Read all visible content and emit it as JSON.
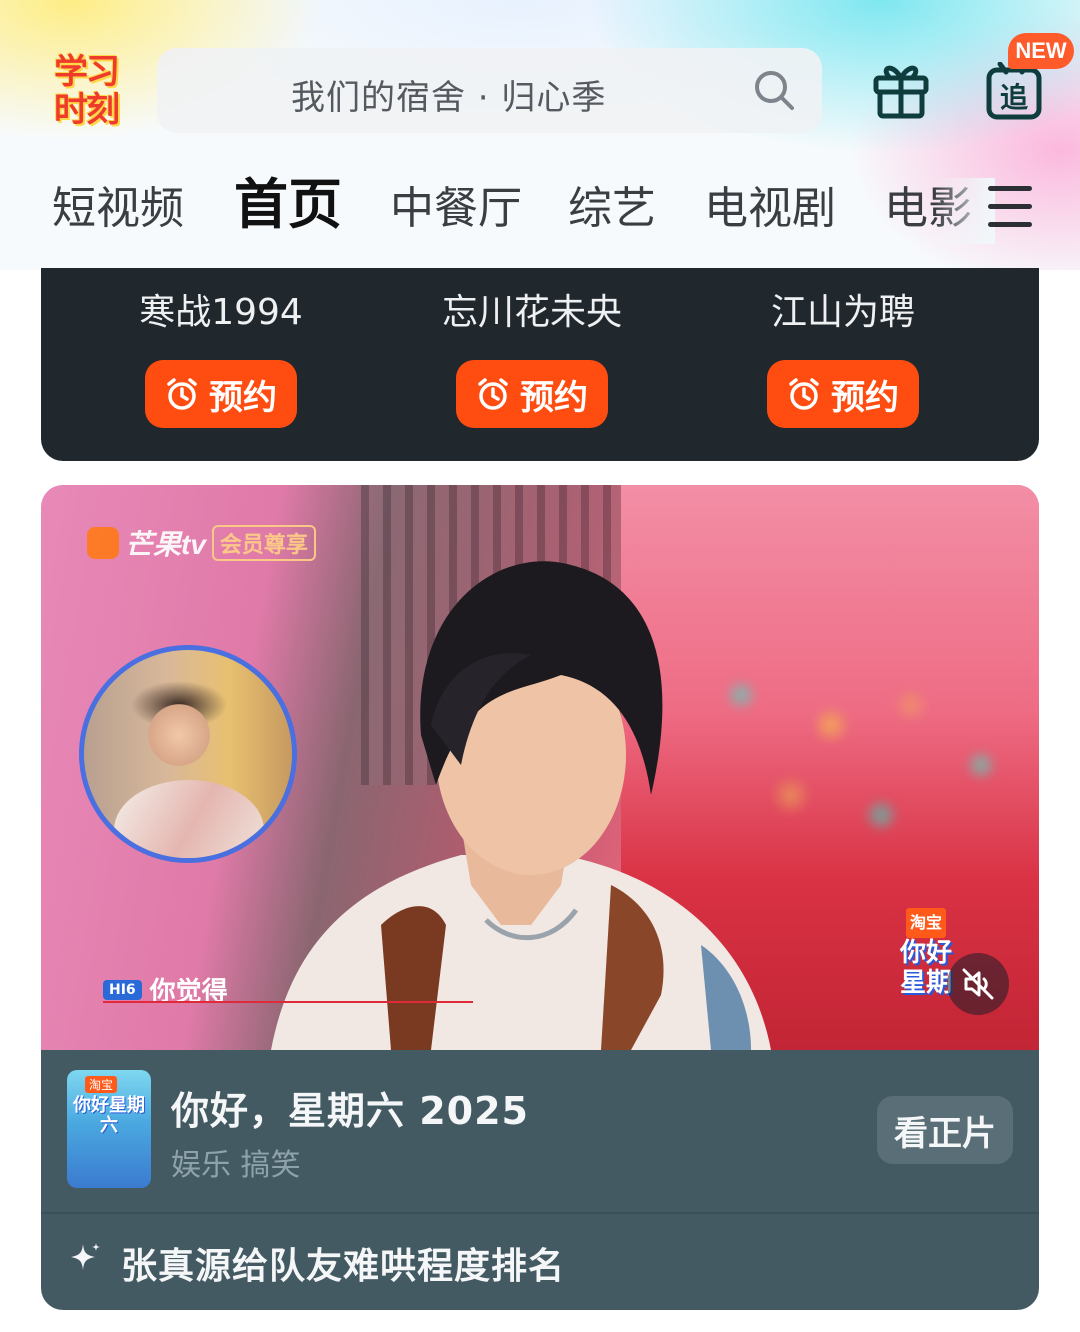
{
  "header": {
    "logo_text_line1": "学习",
    "logo_text_line2": "时刻",
    "search_placeholder": "我们的宿舍 · 归心季",
    "new_badge": "NEW",
    "chase_label": "追"
  },
  "nav": {
    "tabs": [
      {
        "label": "短视频",
        "active": false
      },
      {
        "label": "首页",
        "active": true
      },
      {
        "label": "中餐厅",
        "active": false
      },
      {
        "label": "综艺",
        "active": false
      },
      {
        "label": "电视剧",
        "active": false
      },
      {
        "label": "电影",
        "active": false
      }
    ]
  },
  "upcoming": {
    "items": [
      {
        "title": "寒战1994",
        "button": "预约"
      },
      {
        "title": "忘川花未央",
        "button": "预约"
      },
      {
        "title": "江山为聘",
        "button": "预约"
      }
    ]
  },
  "video": {
    "watermark_brand": "芒果tv",
    "watermark_sub": "会员尊享",
    "subtitle_tag": "HI6",
    "subtitle_text": "你觉得",
    "logo_badge": "淘宝",
    "logo_line1": "你好",
    "logo_line2": "星期"
  },
  "show": {
    "poster_badge": "淘宝",
    "poster_title": "你好星期六",
    "name": "你好，星期六 2025",
    "genre": "娱乐 搞笑",
    "watch_button": "看正片",
    "topic": "张真源给队友难哄程度排名"
  },
  "colors": {
    "accent_orange": "#ff4d12",
    "dark_card": "#20272d",
    "info_bar": "#445a63"
  }
}
